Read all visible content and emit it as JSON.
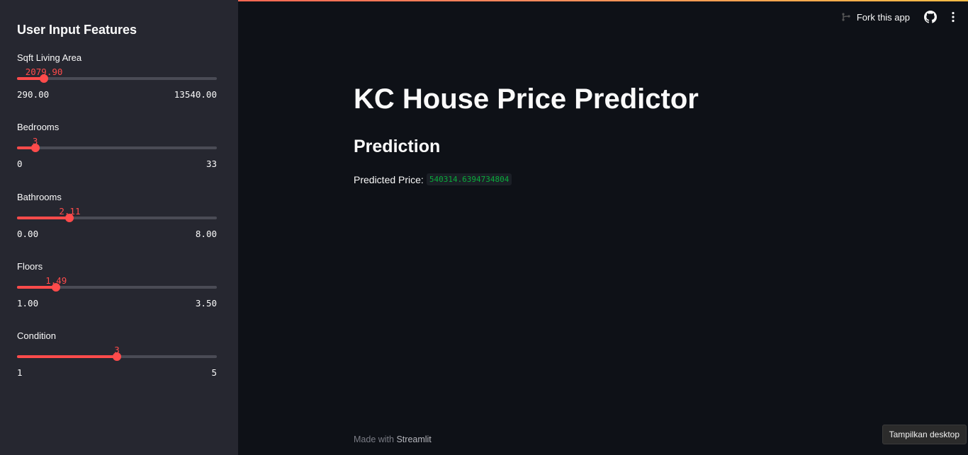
{
  "sidebar": {
    "title": "User Input Features",
    "sliders": [
      {
        "label": "Sqft Living Area",
        "value": "2079.90",
        "min": "290.00",
        "max": "13540.00",
        "fraction": 0.135
      },
      {
        "label": "Bedrooms",
        "value": "3",
        "min": "0",
        "max": "33",
        "fraction": 0.091
      },
      {
        "label": "Bathrooms",
        "value": "2.11",
        "min": "0.00",
        "max": "8.00",
        "fraction": 0.264
      },
      {
        "label": "Floors",
        "value": "1.49",
        "min": "1.00",
        "max": "3.50",
        "fraction": 0.196
      },
      {
        "label": "Condition",
        "value": "3",
        "min": "1",
        "max": "5",
        "fraction": 0.5
      }
    ]
  },
  "header": {
    "fork_label": "Fork this app",
    "github_icon": "github-icon",
    "menu_icon": "kebab-menu-icon"
  },
  "main": {
    "title": "KC House Price Predictor",
    "subtitle": "Prediction",
    "prediction_label": "Predicted Price:",
    "prediction_value": "540314.6394734804"
  },
  "footer": {
    "prefix": "Made with",
    "brand": "Streamlit"
  },
  "tooltip": "Tampilkan desktop",
  "colors": {
    "accent": "#ff4b4b",
    "background": "#0e1117",
    "sidebar": "#262730",
    "code_text": "#09ab3b"
  }
}
